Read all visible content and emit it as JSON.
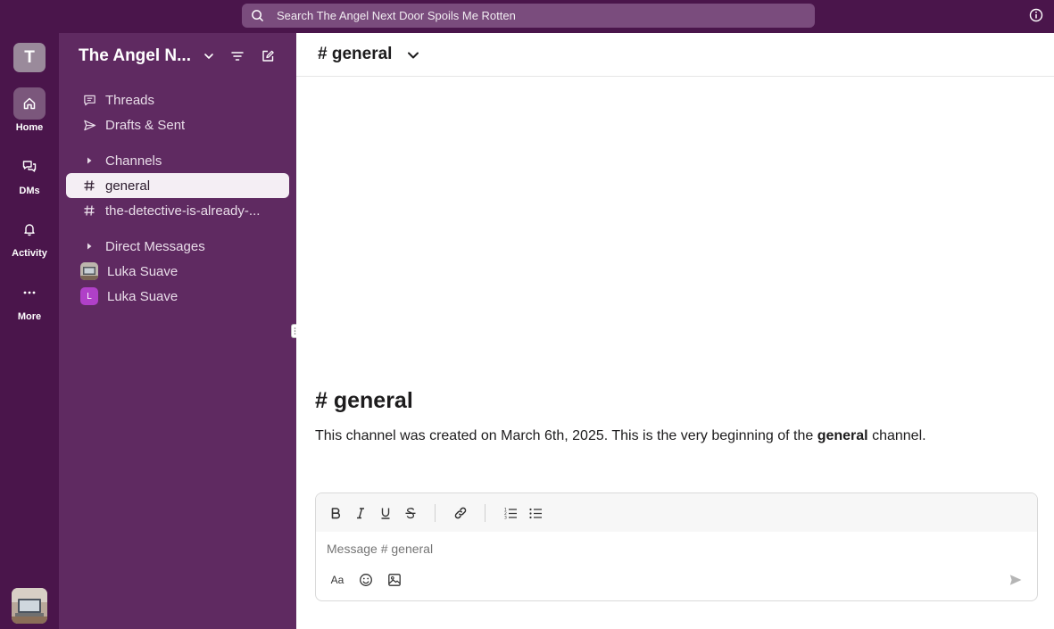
{
  "search": {
    "placeholder": "Search The Angel Next Door Spoils Me Rotten"
  },
  "rail": {
    "workspace_initial": "T",
    "items": [
      {
        "label": "Home",
        "icon": "home-icon"
      },
      {
        "label": "DMs",
        "icon": "dms-icon"
      },
      {
        "label": "Activity",
        "icon": "bell-icon"
      },
      {
        "label": "More",
        "icon": "more-icon"
      }
    ]
  },
  "sidebar": {
    "workspace_name": "The Angel N...",
    "threads_label": "Threads",
    "drafts_label": "Drafts & Sent",
    "channels_label": "Channels",
    "channels": [
      "general",
      "the-detective-is-already-..."
    ],
    "dms_label": "Direct Messages",
    "dms": [
      {
        "name": "Luka Suave",
        "avatar": "photo"
      },
      {
        "name": "Luka Suave",
        "avatar": "L"
      }
    ]
  },
  "channel": {
    "header": "# general",
    "intro_title": "# general",
    "intro_prefix": "This channel was created on March 6th, 2025. This is the very beginning of the ",
    "intro_channel": "general",
    "intro_suffix": " channel."
  },
  "composer": {
    "placeholder": "Message # general",
    "format_label": "Aa"
  },
  "colors": {
    "aubergine": "#4a154b",
    "sidebar": "#5f2a61",
    "active_row": "#f4eef4",
    "dm_badge": "#b040c8"
  }
}
